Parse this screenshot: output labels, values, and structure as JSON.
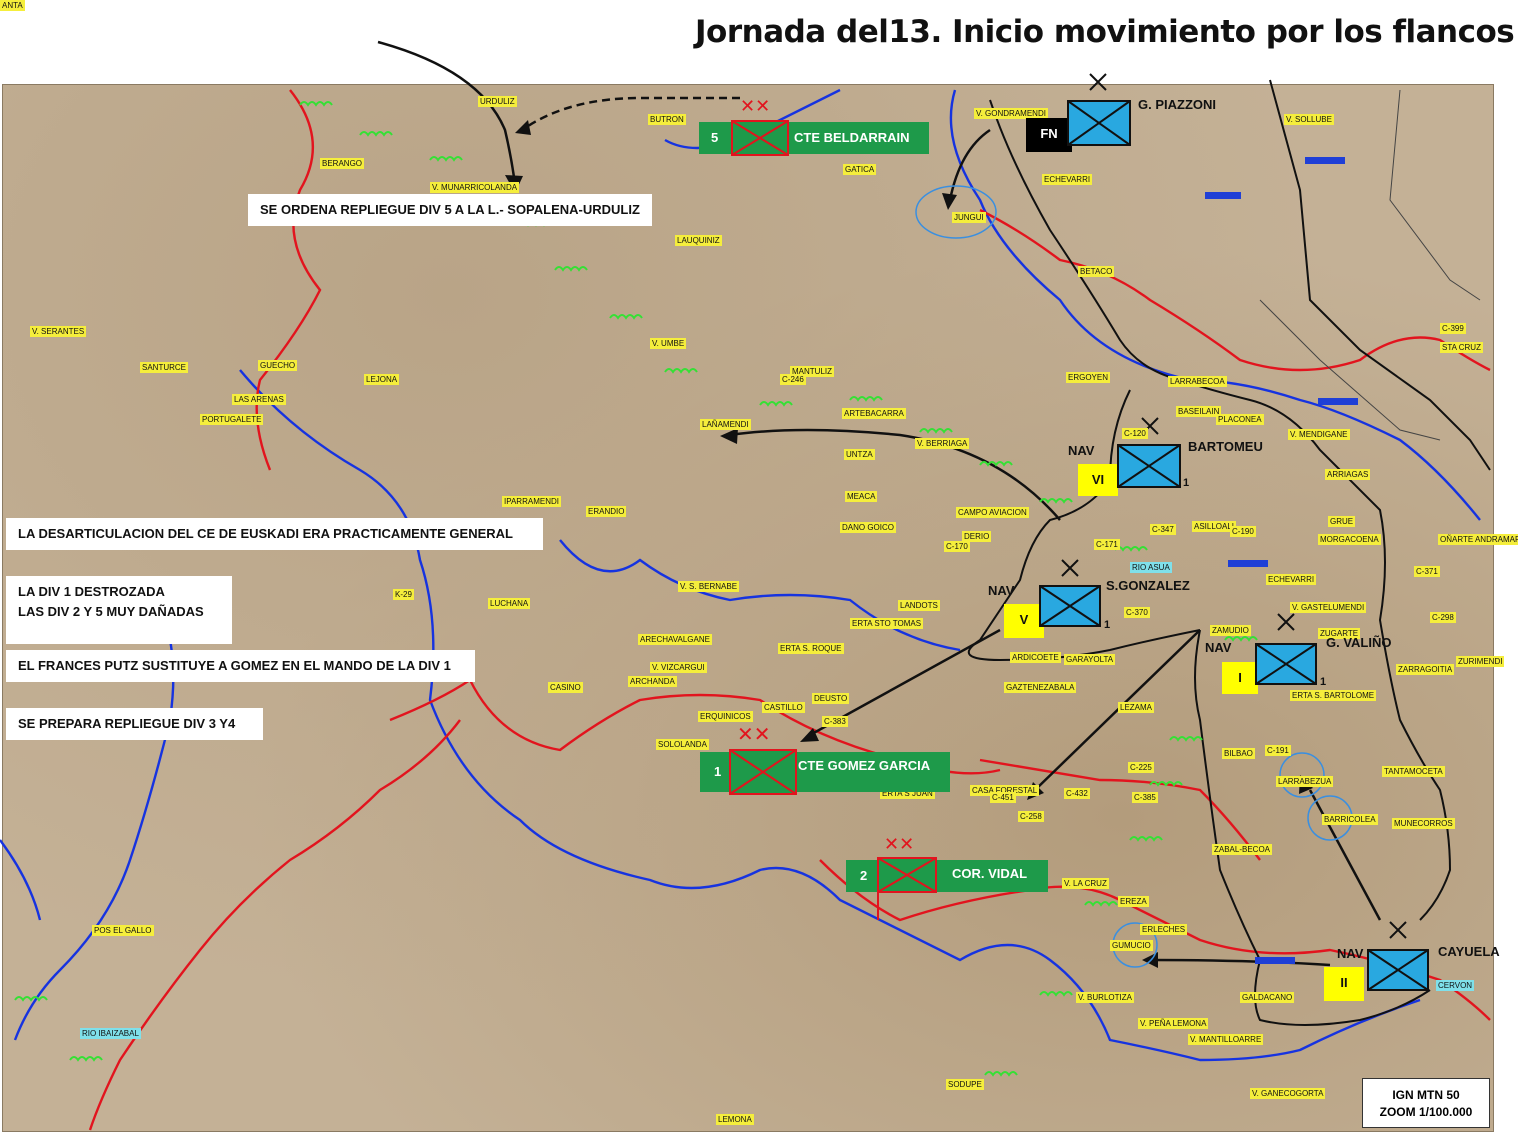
{
  "title": "Jornada del13. Inicio movimiento por los flancos",
  "source_box": {
    "line1": "IGN MTN 50",
    "line2": "ZOOM 1/100.000"
  },
  "notes": [
    "SE ORDENA REPLIEGUE DIV 5 A LA L.- SOPALENA-URDULIZ",
    "LA DESARTICULACION DEL CE  DE EUSKADI ERA PRACTICAMENTE GENERAL",
    "LA DIV 1  DESTROZADA",
    "LAS DIV  2 Y 5 MUY DAÑADAS",
    "EL FRANCES PUTZ  SUSTITUYE A GOMEZ EN EL MANDO DE LA DIV 1",
    "SE PREPARA REPLIEGUE DIV 3 Y4"
  ],
  "republican_units": [
    {
      "number": "5",
      "commander": "CTE BELDARRAIN"
    },
    {
      "number": "1",
      "commander": "CTE GOMEZ GARCIA"
    },
    {
      "number": "2",
      "commander": "COR. VIDAL"
    }
  ],
  "nationalist_units": [
    {
      "label": "FN",
      "commander": "G. PIAZZONI",
      "number": ""
    },
    {
      "prefix": "NAV",
      "label": "VI",
      "commander": "BARTOMEU",
      "number": "1"
    },
    {
      "prefix": "NAV",
      "label": "V",
      "commander": "S.GONZALEZ",
      "number": "1"
    },
    {
      "prefix": "NAV",
      "label": "I",
      "commander": "G. VALIÑO",
      "number": "1"
    },
    {
      "prefix": "NAV",
      "label": "II",
      "commander": "CAYUELA",
      "number": ""
    }
  ],
  "place_labels": [
    "URDULIZ",
    "BUTRON",
    "BERANGO",
    "V. GONDRAMENDI",
    "V. SOLLUBE",
    "GATICA",
    "V. MUNARRICOLANDA",
    "ECHEVARRI",
    "LAUQUINIZ",
    "JUNGUI",
    "BETACO",
    "V. SERANTES",
    "SANTURCE",
    "GUECHO",
    "LEJONA",
    "V. UMBE",
    "MANTULIZ",
    "C-246",
    "LAS ARENAS",
    "PORTUGALETE",
    "ARTEBACARRA",
    "LAÑAMENDI",
    "ERGOYEN",
    "LARRABECOA",
    "BASEILAIN",
    "PLACONEA",
    "V. MENDIGANE",
    "C-399",
    "STA CRUZ",
    "V. BERRIAGA",
    "UNTZA",
    "C-120",
    "ARRIAGAS",
    "MEACA",
    "IPARRAMENDI",
    "ERANDIO",
    "CAMPO AVIACION",
    "DANO GOICO",
    "DERIO",
    "C-170",
    "C-171",
    "C-347",
    "ASILLOALI",
    "C-190",
    "GRUE",
    "MORGACOENA",
    "OÑARTE ANDRAMARI",
    "K-29",
    "LUCHANA",
    "V. S. BERNABE",
    "RIO ASUA",
    "ECHEVARRI",
    "C-370",
    "V. GASTELUMENDI",
    "C-371",
    "LANDOTS",
    "ERTA STO TOMAS",
    "ZAMUDIO",
    "C-298",
    "ZUGARTE",
    "ARECHAVALGANE",
    "ERTA S. ROQUE",
    "ARDICOETE",
    "GARAYOLTA",
    "ZURIMENDI",
    "ZARRAGOITIA",
    "V. VIZCARGUI",
    "ARCHANDA",
    "CASINO",
    "DEUSTO",
    "GAZTENEZABALA",
    "LEZAMA",
    "ERTA S. BARTOLOME",
    "ERQUINICOS",
    "CASTILLO",
    "C-383",
    "SOLOLANDA",
    "BILBAO",
    "C-191",
    "C-225",
    "LARRABEZUA",
    "TANTAMOCETA",
    "ERTA S JUAN",
    "CASA FORESTAL",
    "C-451",
    "C-432",
    "C-258",
    "C-385",
    "BARRICOLEA",
    "MUNECORROS",
    "ZABAL-BECOA",
    "V. LA CRUZ",
    "POS EL GALLO",
    "EREZA",
    "ERLECHES",
    "GUMUCIO",
    "V. BURLOTIZA",
    "GALDACANO",
    "V. PEÑA LEMONA",
    "V. MANTILLOARRE",
    "RIO IBAIZABAL",
    "SODUPE",
    "V. GANECOGORTA",
    "LEMONA",
    "CERVON",
    "ANTA"
  ]
}
